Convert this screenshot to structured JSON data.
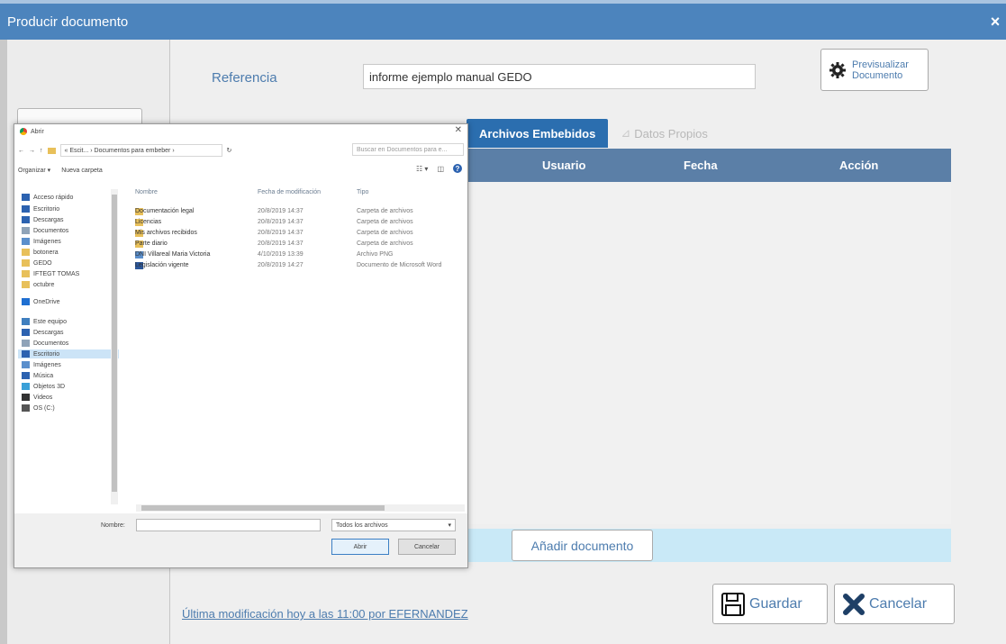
{
  "modal": {
    "title": "Producir documento",
    "close_glyph": "×"
  },
  "form": {
    "reference_label": "Referencia",
    "reference_value": "informe ejemplo manual GEDO",
    "preview_label_line1": "Previsualizar",
    "preview_label_line2": "Documento"
  },
  "tabs": [
    {
      "label": "Archivos Embebidos",
      "active": true
    },
    {
      "label": "Datos Propios",
      "active": false
    }
  ],
  "table": {
    "columns": [
      "Usuario",
      "Fecha",
      "Acción"
    ]
  },
  "add_button_label": "Añadir documento",
  "last_modified": "Última modificación hoy a las 11:00 por EFERNANDEZ",
  "save_label": "Guardar",
  "cancel_label": "Cancelar",
  "dialog": {
    "title": "Abrir",
    "address": "« Escit... › Documentos para embeber ›",
    "search_placeholder": "Buscar en Documentos para e...",
    "organize": "Organizar ▾",
    "new_folder": "Nueva carpeta",
    "nav_items": [
      {
        "label": "Acceso rápido",
        "icon": "star-icon"
      },
      {
        "label": "Escritorio",
        "icon": "desktop-icon"
      },
      {
        "label": "Descargas",
        "icon": "download-icon"
      },
      {
        "label": "Documentos",
        "icon": "document-icon"
      },
      {
        "label": "Imágenes",
        "icon": "image-icon"
      },
      {
        "label": "botonera",
        "icon": "folder-icon"
      },
      {
        "label": "GEDO",
        "icon": "folder-icon"
      },
      {
        "label": "IFTEGT TOMAS",
        "icon": "folder-icon"
      },
      {
        "label": "octubre",
        "icon": "folder-icon"
      },
      {
        "label": "OneDrive",
        "icon": "cloud-icon"
      },
      {
        "label": "Este equipo",
        "icon": "computer-icon"
      },
      {
        "label": "Descargas",
        "icon": "download-icon"
      },
      {
        "label": "Documentos",
        "icon": "document-icon"
      },
      {
        "label": "Escritorio",
        "icon": "desktop-icon"
      },
      {
        "label": "Imágenes",
        "icon": "image-icon"
      },
      {
        "label": "Música",
        "icon": "music-icon"
      },
      {
        "label": "Objetos 3D",
        "icon": "cube-icon"
      },
      {
        "label": "Videos",
        "icon": "video-icon"
      },
      {
        "label": "OS (C:)",
        "icon": "drive-icon"
      }
    ],
    "columns": [
      "Nombre",
      "Fecha de modificación",
      "Tipo"
    ],
    "files": [
      {
        "name": "Documentación legal",
        "date": "20/8/2019 14:37",
        "type": "Carpeta de archivos",
        "icon": "folder-icon"
      },
      {
        "name": "Licencias",
        "date": "20/8/2019 14:37",
        "type": "Carpeta de archivos",
        "icon": "folder-icon"
      },
      {
        "name": "Mis archivos recibidos",
        "date": "20/8/2019 14:37",
        "type": "Carpeta de archivos",
        "icon": "folder-icon"
      },
      {
        "name": "Parte diario",
        "date": "20/8/2019 14:37",
        "type": "Carpeta de archivos",
        "icon": "folder-icon"
      },
      {
        "name": "DNI Villareal Maria Victoria",
        "date": "4/10/2019 13:39",
        "type": "Archivo PNG",
        "icon": "image-file-icon"
      },
      {
        "name": "Legislación vigente",
        "date": "20/8/2019 14:27",
        "type": "Documento de Microsoft Word",
        "icon": "word-file-icon"
      }
    ],
    "name_label": "Nombre:",
    "filter": "Todos los archivos",
    "open_label": "Abrir",
    "cancel_label": "Cancelar"
  },
  "colors": {
    "header_blue": "#4c84bd",
    "tab_blue": "#2b6eaf",
    "table_head": "#5b7fa7",
    "add_bar": "#c9e9f7"
  }
}
